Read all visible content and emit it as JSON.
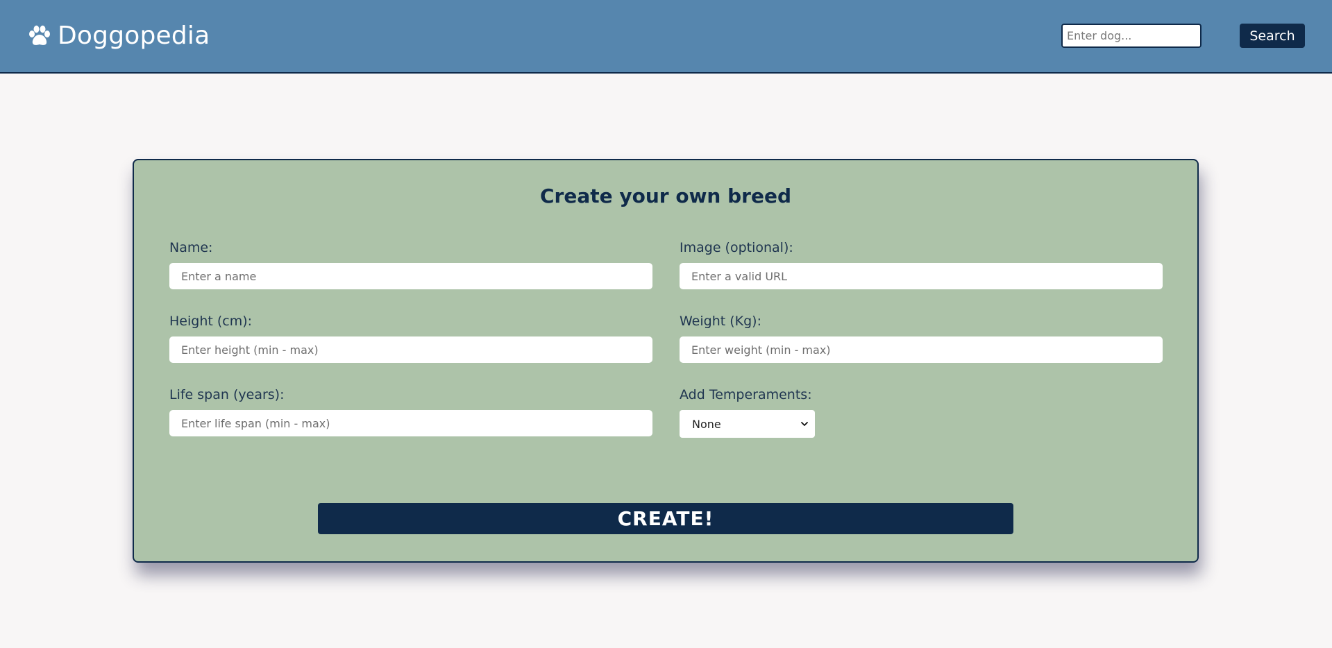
{
  "header": {
    "brand_icon": "paw-icon",
    "brand_name": "Doggopedia",
    "search_placeholder": "Enter dog...",
    "search_button_label": "Search",
    "background_color": "#5686ae"
  },
  "form": {
    "title": "Create your own breed",
    "background_color": "#adc3a9",
    "fields": {
      "name": {
        "label": "Name:",
        "placeholder": "Enter a name",
        "value": ""
      },
      "image": {
        "label": "Image (optional):",
        "placeholder": "Enter a valid URL",
        "value": ""
      },
      "height": {
        "label": "Height (cm):",
        "placeholder": "Enter height (min - max)",
        "value": ""
      },
      "weight": {
        "label": "Weight (Kg):",
        "placeholder": "Enter weight (min - max)",
        "value": ""
      },
      "life_span": {
        "label": "Life span (years):",
        "placeholder": "Enter life span (min - max)",
        "value": ""
      }
    },
    "temperaments": {
      "label": "Add Temperaments:",
      "selected": "None",
      "icon": "chevron-down-icon"
    },
    "submit_label": "CREATE!",
    "accent_color": "#0f2a4a"
  }
}
